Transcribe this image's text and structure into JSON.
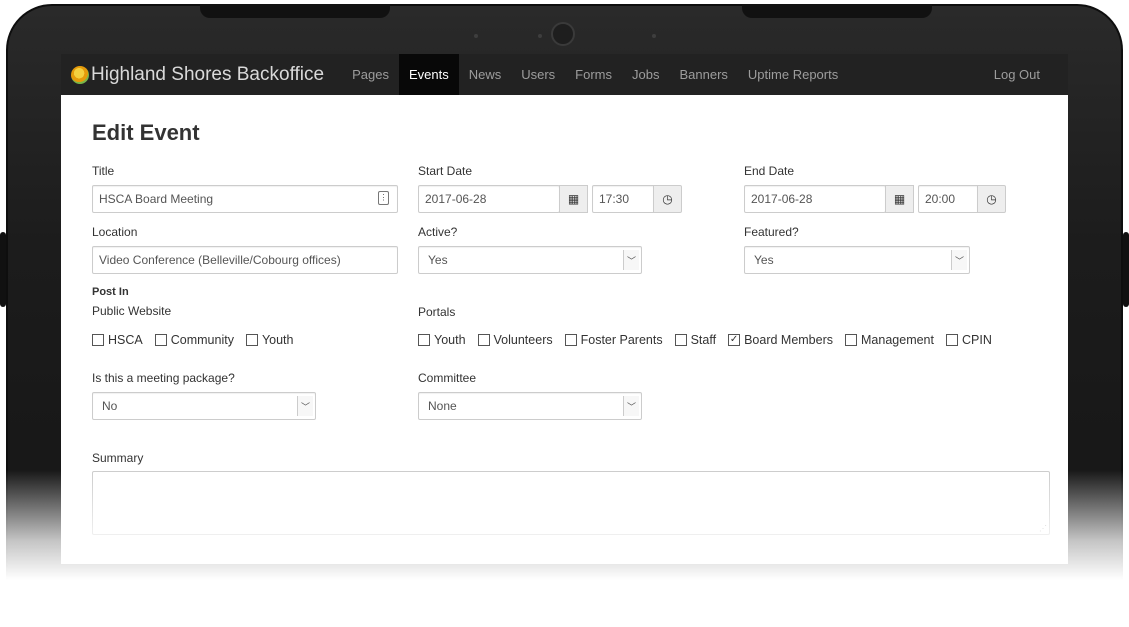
{
  "app": {
    "brand": "Highland Shores Backoffice",
    "nav": [
      "Pages",
      "Events",
      "News",
      "Users",
      "Forms",
      "Jobs",
      "Banners",
      "Uptime Reports"
    ],
    "active_nav": "Events",
    "logout": "Log Out"
  },
  "page": {
    "title": "Edit Event"
  },
  "form": {
    "title": {
      "label": "Title",
      "value": "HSCA Board Meeting"
    },
    "start": {
      "label": "Start Date",
      "date": "2017-06-28",
      "time": "17:30"
    },
    "end": {
      "label": "End Date",
      "date": "2017-06-28",
      "time": "20:00"
    },
    "location": {
      "label": "Location",
      "value": "Video Conference (Belleville/Cobourg offices)"
    },
    "active": {
      "label": "Active?",
      "value": "Yes"
    },
    "featured": {
      "label": "Featured?",
      "value": "Yes"
    },
    "post_in": {
      "label": "Post In",
      "public_label": "Public Website",
      "portals_label": "Portals"
    },
    "public_options": [
      {
        "label": "HSCA",
        "checked": false
      },
      {
        "label": "Community",
        "checked": false
      },
      {
        "label": "Youth",
        "checked": false
      }
    ],
    "portal_options": [
      {
        "label": "Youth",
        "checked": false
      },
      {
        "label": "Volunteers",
        "checked": false
      },
      {
        "label": "Foster Parents",
        "checked": false
      },
      {
        "label": "Staff",
        "checked": false
      },
      {
        "label": "Board Members",
        "checked": true
      },
      {
        "label": "Management",
        "checked": false
      },
      {
        "label": "CPIN",
        "checked": false
      }
    ],
    "meeting_package": {
      "label": "Is this a meeting package?",
      "value": "No"
    },
    "committee": {
      "label": "Committee",
      "value": "None"
    },
    "summary": {
      "label": "Summary",
      "value": ""
    }
  },
  "icons": {
    "calendar": "calendar-icon",
    "clock": "clock-icon",
    "contact_card": "contact-card-icon",
    "select_arrow": "chevron-down-icon"
  }
}
